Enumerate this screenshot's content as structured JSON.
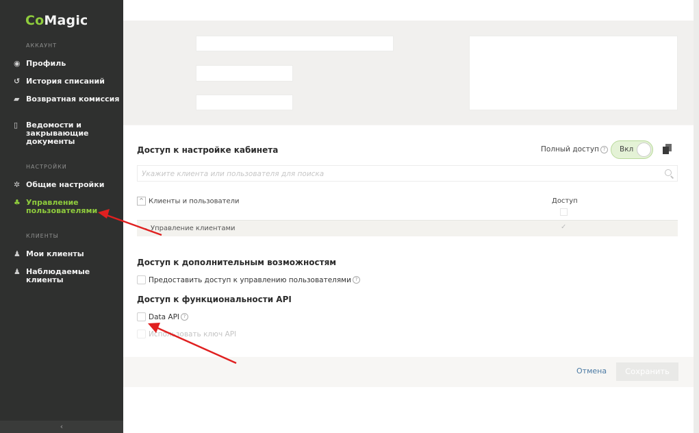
{
  "sidebar": {
    "logo_co": "Co",
    "logo_magic": "Magic",
    "sections": [
      "Аккаунт",
      "Настройки",
      "Клиенты"
    ],
    "items": [
      {
        "label": "Профиль",
        "icon": "profile-icon"
      },
      {
        "label": "История списаний",
        "icon": "history-icon"
      },
      {
        "label": "Возвратная комиссия",
        "icon": "commission-icon"
      },
      {
        "label": "Ведомости и закрывающие документы",
        "icon": "document-icon"
      },
      {
        "label": "Общие настройки",
        "icon": "gear-icon"
      },
      {
        "label": "Управление пользователями",
        "icon": "users-icon",
        "active": true
      },
      {
        "label": "Мои клиенты",
        "icon": "clients-icon"
      },
      {
        "label": "Наблюдаемые клиенты",
        "icon": "watched-clients-icon"
      }
    ],
    "collapse_glyph": "‹"
  },
  "cabinet_access": {
    "title": "Доступ к настройке кабинета",
    "full_access_label": "Полный доступ",
    "toggle_label": "Вкл",
    "toggle_on": true,
    "search_placeholder": "Укажите клиента или пользователя для поиска",
    "col_clients": "Клиенты и пользователи",
    "col_access": "Доступ",
    "rows": [
      {
        "label": "Управление клиентами",
        "checked": true
      }
    ]
  },
  "extra": {
    "title": "Доступ к дополнительным возможностям",
    "option_label": "Предоставить доступ к управлению пользователями"
  },
  "api": {
    "title": "Доступ к функциональности API",
    "data_api_label": "Data API",
    "use_key_label": "Использовать ключ API"
  },
  "footer": {
    "cancel": "Отмена",
    "save": "Сохранить"
  },
  "colors": {
    "accent": "#8fcc3d",
    "sidebar_bg": "#2f302f",
    "link": "#4a79a3",
    "annotation_arrow": "#e02020"
  }
}
